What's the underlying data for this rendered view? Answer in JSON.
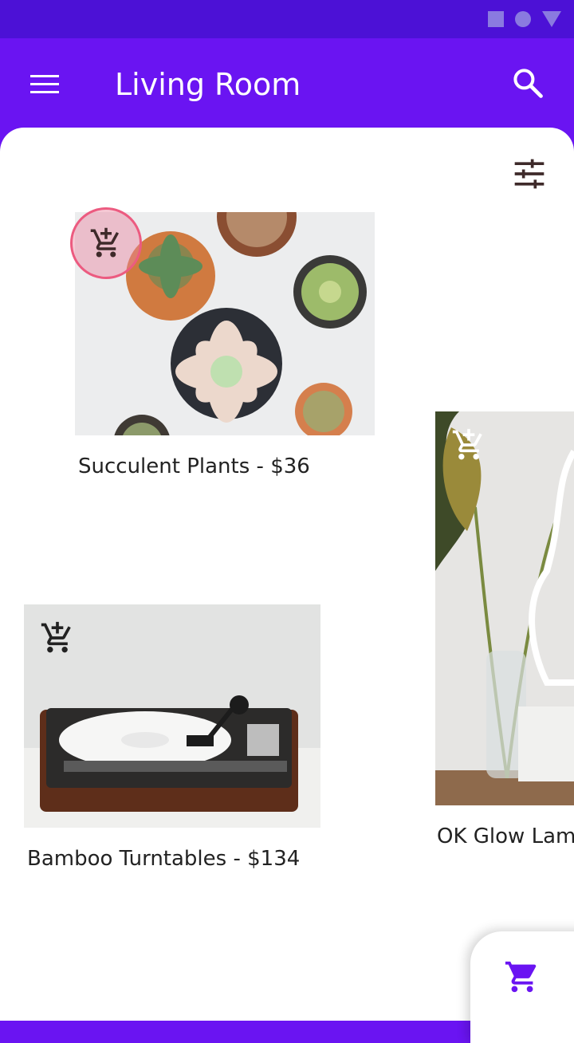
{
  "header": {
    "title": "Living Room"
  },
  "colors": {
    "primary": "#6a14f2",
    "status_bar": "#4c11d6",
    "accent_highlight": "#ec5b80"
  },
  "icons": {
    "menu": "menu-icon",
    "search": "search-icon",
    "filter": "tune-icon",
    "add_cart": "add-shopping-cart-icon",
    "cart": "shopping-cart-icon"
  },
  "products": [
    {
      "name": "Succulent Plants",
      "price": "$36"
    },
    {
      "name": "Bamboo Turntables",
      "price": "$134"
    },
    {
      "name": "OK Glow Lamp",
      "price": ""
    }
  ]
}
